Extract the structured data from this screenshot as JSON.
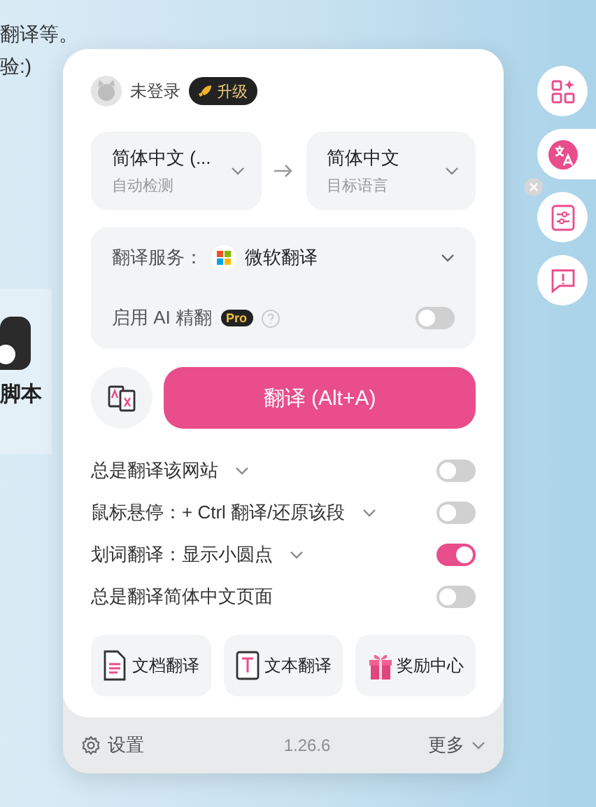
{
  "background": {
    "lines": [
      "翻译等。",
      "验:)"
    ],
    "card_label": "脚本"
  },
  "account": {
    "status": "未登录",
    "upgrade": "升级"
  },
  "languages": {
    "source": {
      "name": "简体中文 (...",
      "hint": "自动检测"
    },
    "target": {
      "name": "简体中文",
      "hint": "目标语言"
    }
  },
  "service": {
    "label": "翻译服务：",
    "value": "微软翻译",
    "ai_label": "启用 AI 精翻",
    "ai_badge": "Pro",
    "ai_on": false
  },
  "translate_button": "翻译 (Alt+A)",
  "toggles": [
    {
      "label": "总是翻译该网站",
      "has_menu": true,
      "on": false
    },
    {
      "label": "鼠标悬停：+ Ctrl 翻译/还原该段",
      "has_menu": true,
      "on": false
    },
    {
      "label": "划词翻译：显示小圆点",
      "has_menu": true,
      "on": true
    },
    {
      "label": "总是翻译简体中文页面",
      "has_menu": false,
      "on": false
    }
  ],
  "tools": [
    {
      "kind": "document",
      "label": "文档翻译"
    },
    {
      "kind": "text",
      "label": "文本翻译"
    },
    {
      "kind": "gift",
      "label": "奖励中心"
    }
  ],
  "footer": {
    "settings": "设置",
    "version": "1.26.6",
    "more": "更多"
  },
  "side_buttons": [
    {
      "kind": "apps",
      "selected": false
    },
    {
      "kind": "translate",
      "selected": true
    },
    {
      "kind": "sliders",
      "selected": false
    },
    {
      "kind": "feedback",
      "selected": false
    }
  ]
}
